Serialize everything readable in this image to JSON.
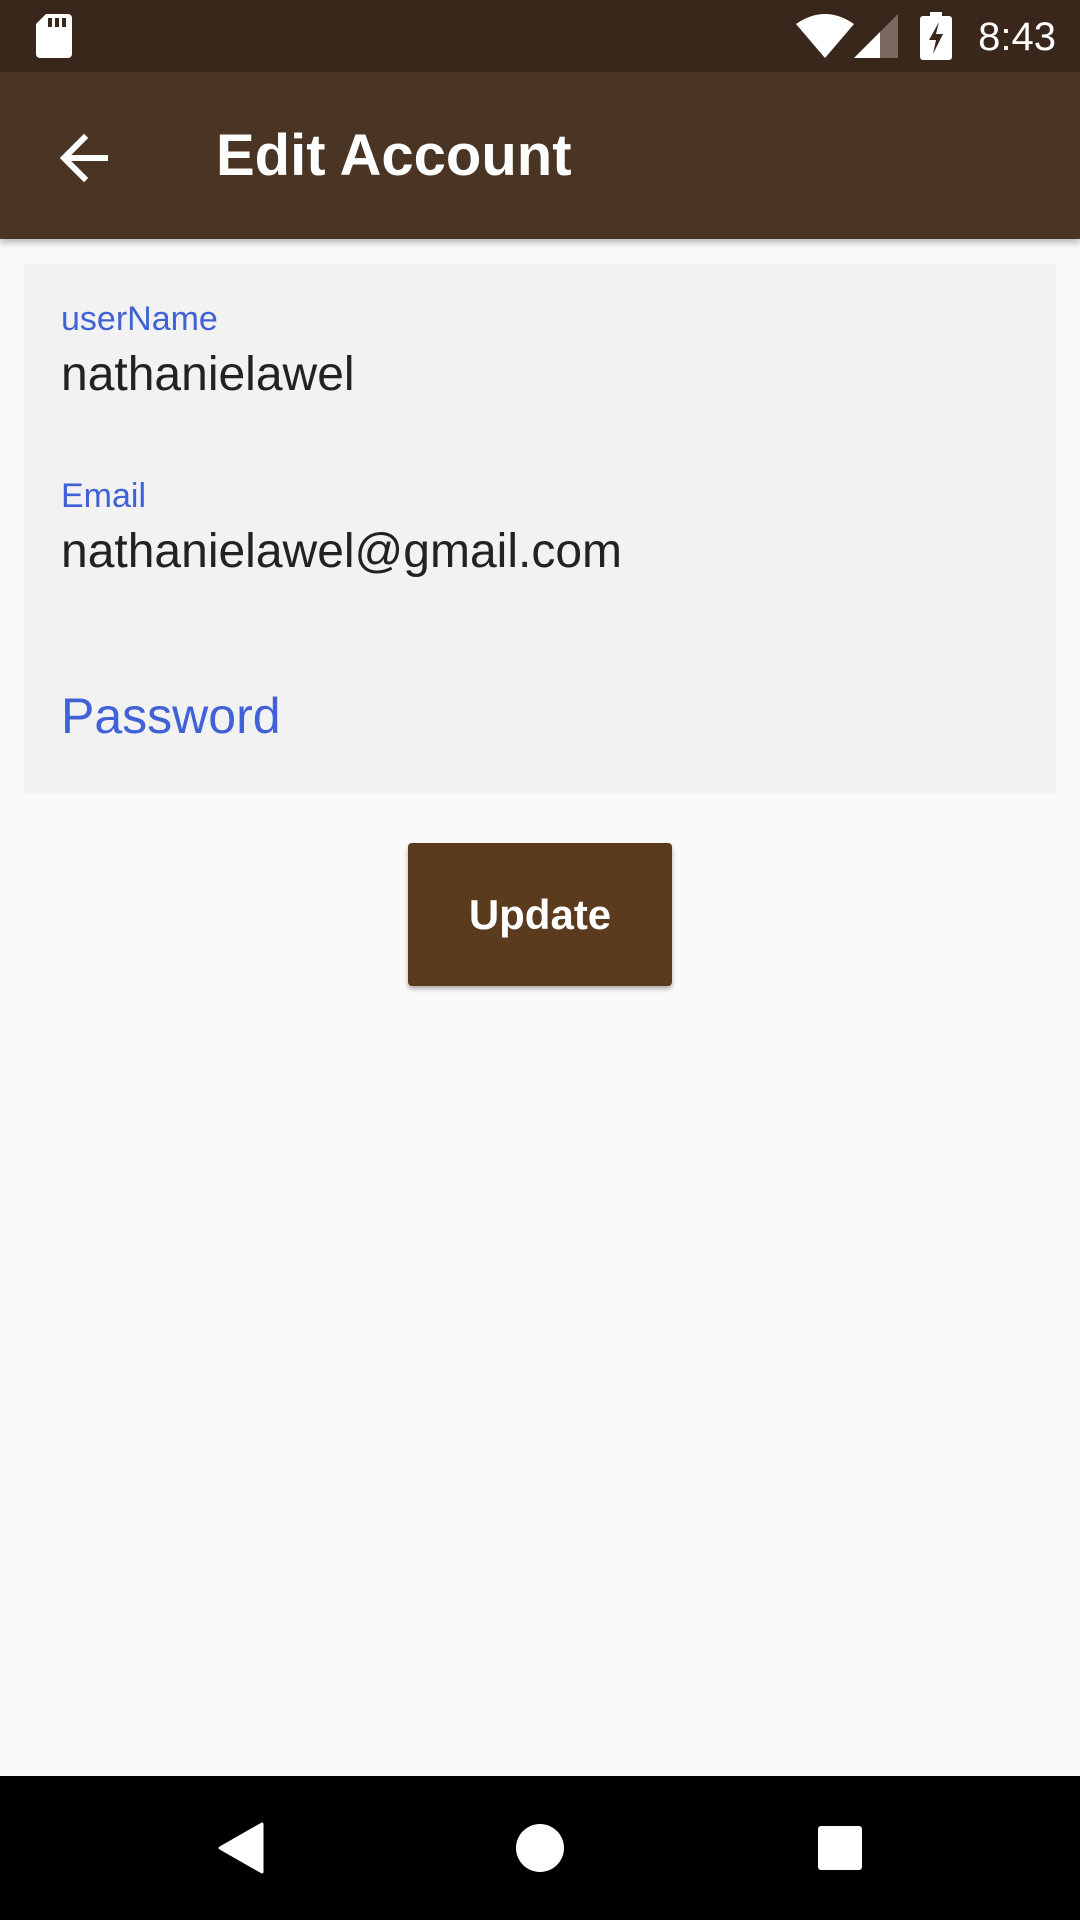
{
  "status_bar": {
    "time": "8:43",
    "icons": [
      "sd-card-icon",
      "wifi-icon",
      "cell-signal-icon",
      "battery-charging-icon"
    ]
  },
  "app_bar": {
    "title": "Edit Account",
    "back_icon": "arrow-back-icon"
  },
  "form": {
    "username": {
      "label": "userName",
      "value": "nathanielawel"
    },
    "email": {
      "label": "Email",
      "value": "nathanielawel@gmail.com"
    },
    "password": {
      "placeholder": "Password",
      "value": ""
    }
  },
  "actions": {
    "update_label": "Update"
  },
  "nav_bar": {
    "icons": [
      "back-triangle-icon",
      "home-circle-icon",
      "recents-square-icon"
    ]
  },
  "colors": {
    "status_bar": "#3a271b",
    "app_bar": "#4a3424",
    "accent_label": "#4161d6",
    "button": "#5a3b1e",
    "form_background": "#f2f2f2",
    "page_background": "#fafafa"
  }
}
